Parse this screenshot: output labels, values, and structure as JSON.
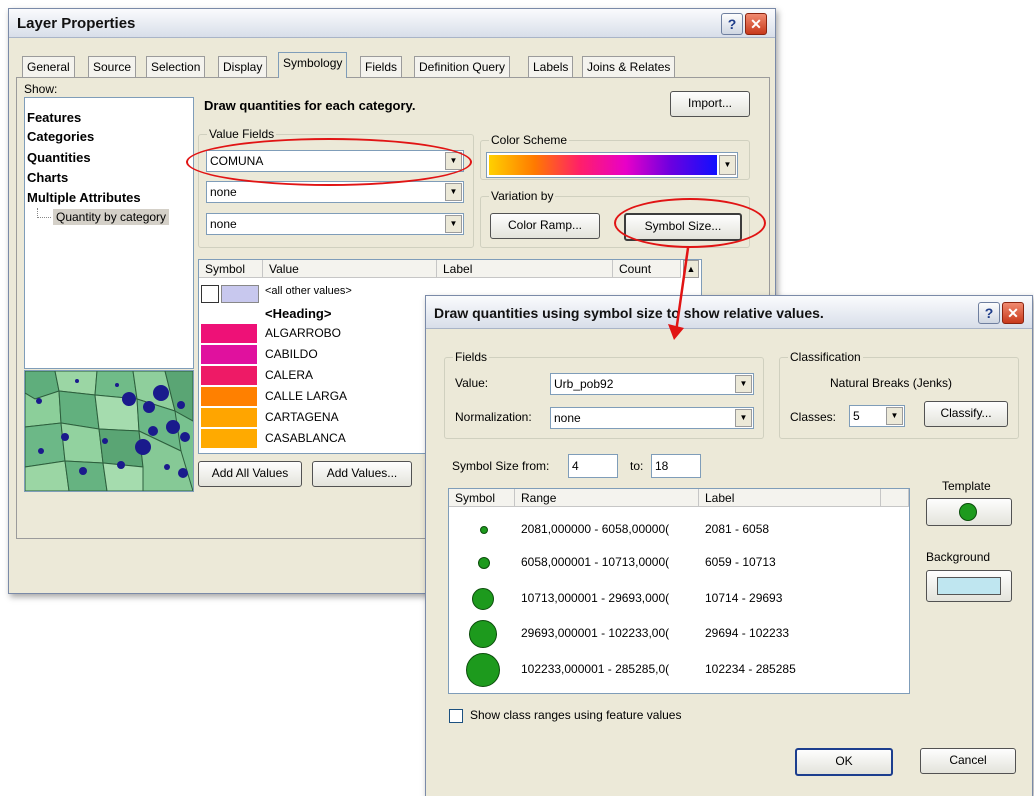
{
  "layer_properties": {
    "title": "Layer Properties",
    "help_label": "?",
    "close_label": "✕",
    "tabs": [
      "General",
      "Source",
      "Selection",
      "Display",
      "Symbology",
      "Fields",
      "Definition Query",
      "Labels",
      "Joins & Relates"
    ],
    "active_tab": "Symbology",
    "show_label": "Show:",
    "show_items": [
      "Features",
      "Categories",
      "Quantities",
      "Charts",
      "Multiple Attributes"
    ],
    "show_subitem": "Quantity by category",
    "description": "Draw quantities for each category.",
    "import_label": "Import...",
    "value_fields_label": "Value Fields",
    "value_fields": [
      "COMUNA",
      "none",
      "none"
    ],
    "color_scheme_label": "Color Scheme",
    "variation_label": "Variation by",
    "color_ramp_label": "Color Ramp...",
    "symbol_size_label": "Symbol Size...",
    "table_headers": [
      "Symbol",
      "Value",
      "Label",
      "Count"
    ],
    "rows": [
      {
        "value": "<all other values>",
        "color": "#c8c8ee"
      },
      {
        "value": "<Heading>",
        "color": ""
      },
      {
        "value": "ALGARROBO",
        "color": "#ee1177"
      },
      {
        "value": "CABILDO",
        "color": "#e0119e"
      },
      {
        "value": "CALERA",
        "color": "#ee1a66"
      },
      {
        "value": "CALLE LARGA",
        "color": "#ff8000"
      },
      {
        "value": "CARTAGENA",
        "color": "#ffa500"
      },
      {
        "value": "CASABLANCA",
        "color": "#ffaa00"
      }
    ],
    "add_all_label": "Add All Values",
    "add_values_label": "Add Values..."
  },
  "dialog": {
    "title": "Draw quantities using symbol size to show relative values.",
    "help_label": "?",
    "close_label": "✕",
    "fields_label": "Fields",
    "value_label": "Value:",
    "value_field": "Urb_pob92",
    "normalization_label": "Normalization:",
    "normalization_value": "none",
    "classification_label": "Classification",
    "method": "Natural Breaks (Jenks)",
    "classes_label": "Classes:",
    "classes_value": "5",
    "classify_label": "Classify...",
    "size_from_label": "Symbol Size from:",
    "size_from": "4",
    "size_to_label": "to:",
    "size_to": "18",
    "headers": [
      "Symbol",
      "Range",
      "Label"
    ],
    "classes": [
      {
        "range": "2081,000000 - 6058,00000(",
        "label": "2081 - 6058",
        "size": 4
      },
      {
        "range": "6058,000001 - 10713,0000(",
        "label": "6059 - 10713",
        "size": 7
      },
      {
        "range": "10713,000001 - 29693,000(",
        "label": "10714 - 29693",
        "size": 11
      },
      {
        "range": "29693,000001 - 102233,00(",
        "label": "29694 - 102233",
        "size": 14
      },
      {
        "range": "102233,000001 - 285285,0(",
        "label": "102234 - 285285",
        "size": 18
      }
    ],
    "template_label": "Template",
    "background_label": "Background",
    "show_ranges_label": "Show class ranges using feature values",
    "ok_label": "OK",
    "cancel_label": "Cancel"
  },
  "colors": {
    "symbol_fill": "#1d9a1d",
    "background_swatch": "#bfe6f0",
    "highlight": "#e11414"
  }
}
